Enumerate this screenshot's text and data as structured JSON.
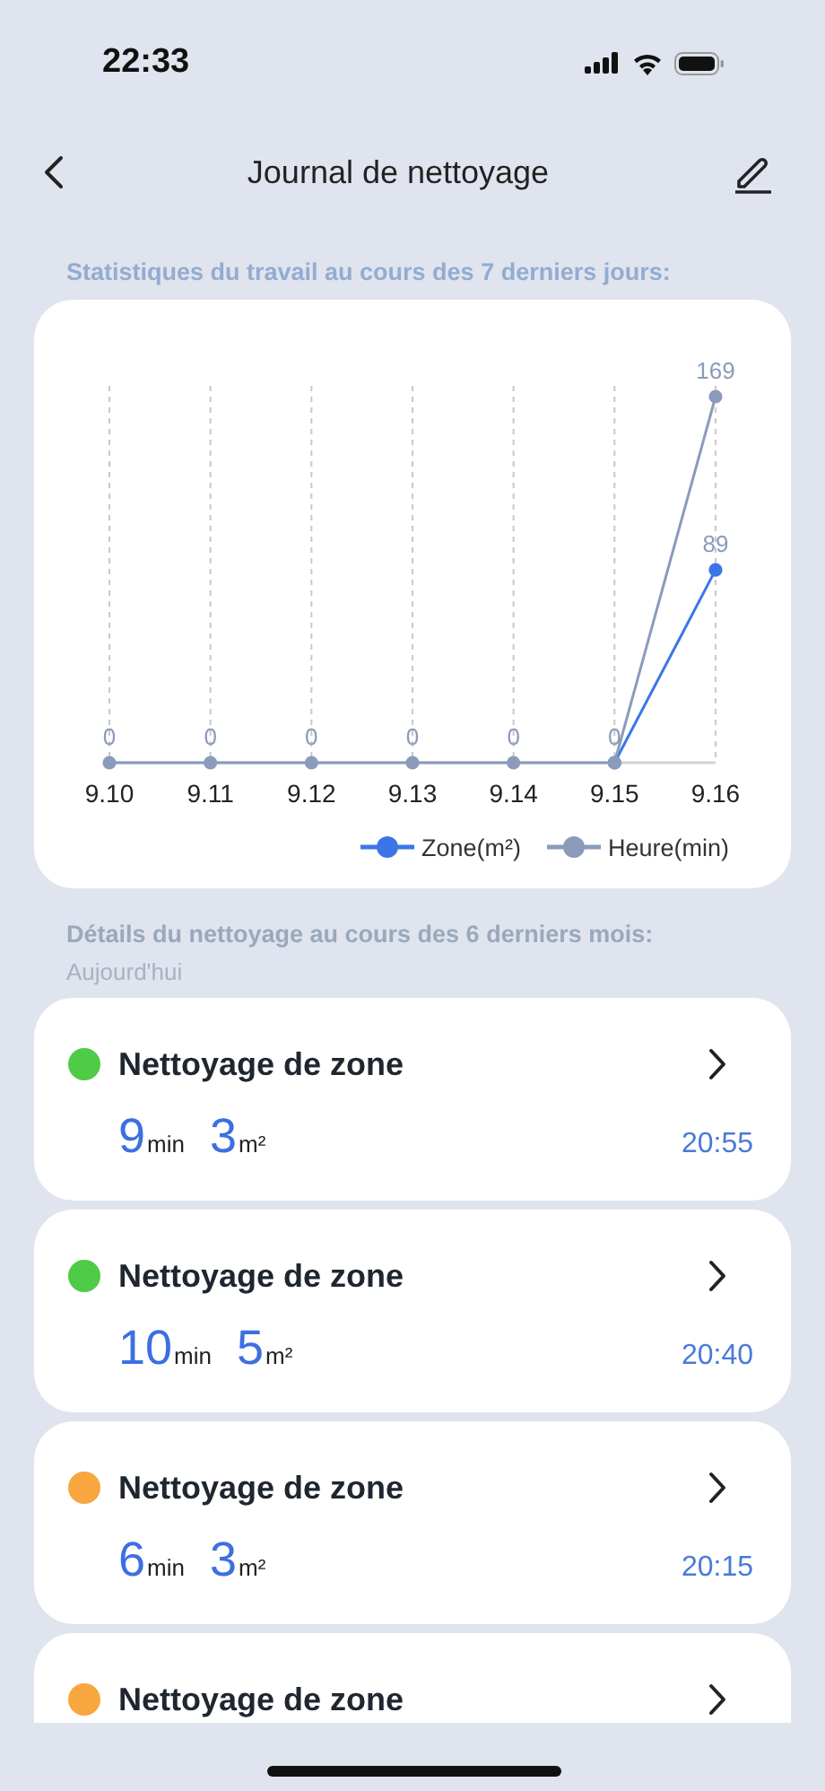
{
  "status_bar": {
    "time": "22:33"
  },
  "nav_bar": {
    "title": "Journal de nettoyage"
  },
  "stats": {
    "heading": "Statistiques du travail au cours des 7 derniers jours:",
    "chart_data": {
      "type": "line",
      "categories": [
        "9.10",
        "9.11",
        "9.12",
        "9.13",
        "9.14",
        "9.15",
        "9.16"
      ],
      "grid": true,
      "legend": true,
      "series": [
        {
          "name": "Zone(m²)",
          "color": "#3b76e8",
          "marker": "circle",
          "values": [
            null,
            null,
            null,
            null,
            null,
            0,
            89
          ],
          "value_labels": [
            null,
            null,
            null,
            null,
            null,
            null,
            "89"
          ]
        },
        {
          "name": "Heure(min)",
          "color": "#8a9bbb",
          "marker": "circle",
          "values": [
            0,
            0,
            0,
            0,
            0,
            0,
            169
          ],
          "value_labels": [
            "0",
            "0",
            "0",
            "0",
            "0",
            "0",
            "169"
          ]
        }
      ]
    }
  },
  "details": {
    "heading": "Détails du nettoyage au cours des 6 derniers mois:",
    "group": "Aujourd'hui",
    "records": [
      {
        "title": "Nettoyage de zone",
        "color": "#4fcb47",
        "duration": "9",
        "duration_unit": "min",
        "area": "3",
        "area_unit": "m²",
        "time": "20:55"
      },
      {
        "title": "Nettoyage de zone",
        "color": "#4fcb47",
        "duration": "10",
        "duration_unit": "min",
        "area": "5",
        "area_unit": "m²",
        "time": "20:40"
      },
      {
        "title": "Nettoyage de zone",
        "color": "#f7a640",
        "duration": "6",
        "duration_unit": "min",
        "area": "3",
        "area_unit": "m²",
        "time": "20:15"
      },
      {
        "title": "Nettoyage de zone",
        "color": "#f7a640"
      }
    ]
  }
}
